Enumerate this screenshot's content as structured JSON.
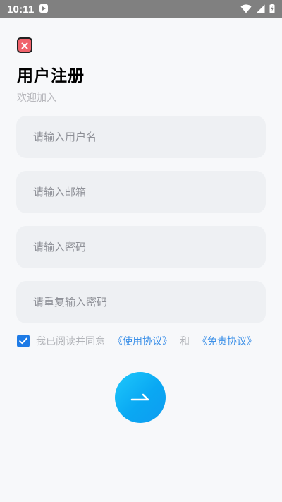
{
  "status_bar": {
    "time": "10:11"
  },
  "page": {
    "title": "用户注册",
    "subtitle": "欢迎加入"
  },
  "form": {
    "username_placeholder": "请输入用户名",
    "email_placeholder": "请输入邮箱",
    "password_placeholder": "请输入密码",
    "confirm_password_placeholder": "请重复输入密码"
  },
  "agreement": {
    "checked": true,
    "prefix": "我已阅读并同意",
    "terms_link": "《使用协议》",
    "conjunction": "和",
    "disclaimer_link": "《免责协议》"
  },
  "colors": {
    "close_button": "#f0626b",
    "checkbox": "#1e7be6",
    "link": "#3a8fe8",
    "submit_gradient_start": "#1ec8fb",
    "submit_gradient_end": "#0d9cf0",
    "field_background": "#eef0f3"
  },
  "icons": {
    "close": "close-icon",
    "check": "check-icon",
    "submit": "arrow-right-icon",
    "status_app": "play-store-icon",
    "wifi": "wifi-icon",
    "signal": "signal-icon",
    "battery": "battery-icon"
  }
}
